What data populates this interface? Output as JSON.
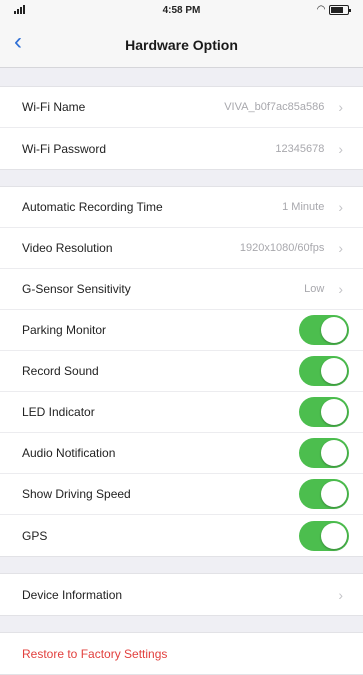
{
  "status_bar": {
    "time": "4:58 PM",
    "battery_level": 0.7
  },
  "nav": {
    "back_icon": "chevron-left-icon",
    "title": "Hardware Option"
  },
  "groups": {
    "wifi": [
      {
        "label": "Wi-Fi Name",
        "value": "VIVA_b0f7ac85a586"
      },
      {
        "label": "Wi-Fi Password",
        "value": "12345678"
      }
    ],
    "recording": [
      {
        "label": "Automatic Recording Time",
        "value": "1 Minute"
      },
      {
        "label": "Video Resolution",
        "value": "1920x1080/60fps"
      },
      {
        "label": "G-Sensor Sensitivity",
        "value": "Low"
      }
    ],
    "toggles": [
      {
        "label": "Parking Monitor",
        "on": true
      },
      {
        "label": "Record Sound",
        "on": true
      },
      {
        "label": "LED Indicator",
        "on": true
      },
      {
        "label": "Audio Notification",
        "on": true
      },
      {
        "label": "Show Driving Speed",
        "on": true
      },
      {
        "label": "GPS",
        "on": true
      }
    ],
    "info": [
      {
        "label": "Device Information"
      }
    ],
    "restore": {
      "label": "Restore to Factory Settings"
    }
  },
  "colors": {
    "toggle_on": "#4cbe4e",
    "accent": "#2f6fd6",
    "destructive": "#e2403e"
  }
}
